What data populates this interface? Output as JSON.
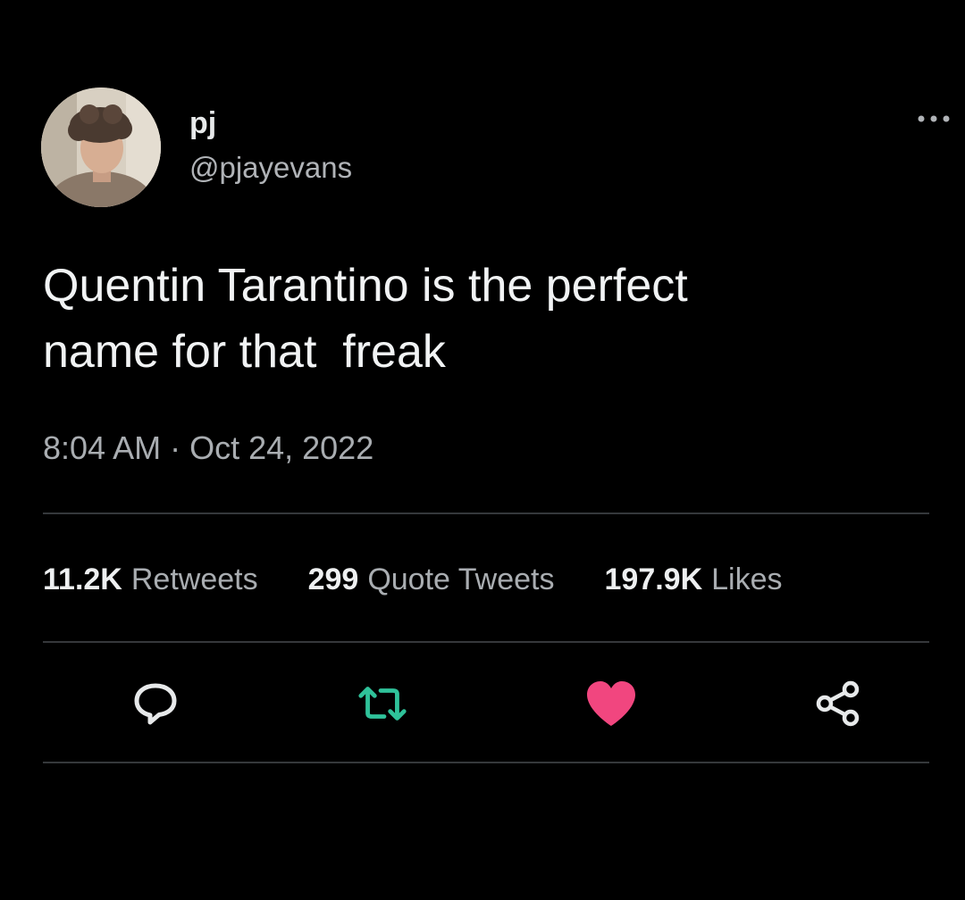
{
  "author": {
    "display_name": "pj",
    "handle": "@pjayevans"
  },
  "tweet": {
    "text": "Quentin Tarantino is the perfect\nname for that  freak",
    "timestamp": "8:04 AM · Oct 24, 2022"
  },
  "stats": [
    {
      "count": "11.2K",
      "label": "Retweets"
    },
    {
      "count": "299",
      "label": "Quote Tweets"
    },
    {
      "count": "197.9K",
      "label": "Likes"
    }
  ],
  "actions": [
    {
      "name": "reply",
      "icon": "speech-bubble-icon",
      "color": "#e7e9ea"
    },
    {
      "name": "retweet",
      "icon": "retweet-icon",
      "color": "#2fc29a"
    },
    {
      "name": "like",
      "icon": "heart-icon",
      "color": "#f1467f",
      "state": "liked"
    },
    {
      "name": "share",
      "icon": "share-icon",
      "color": "#e7e9ea"
    }
  ],
  "colors": {
    "background": "#000000",
    "text_primary": "#e7e9ea",
    "text_secondary": "#a9adb1",
    "divider": "#35383b",
    "retweet_green": "#2fc29a",
    "like_pink": "#f1467f"
  }
}
